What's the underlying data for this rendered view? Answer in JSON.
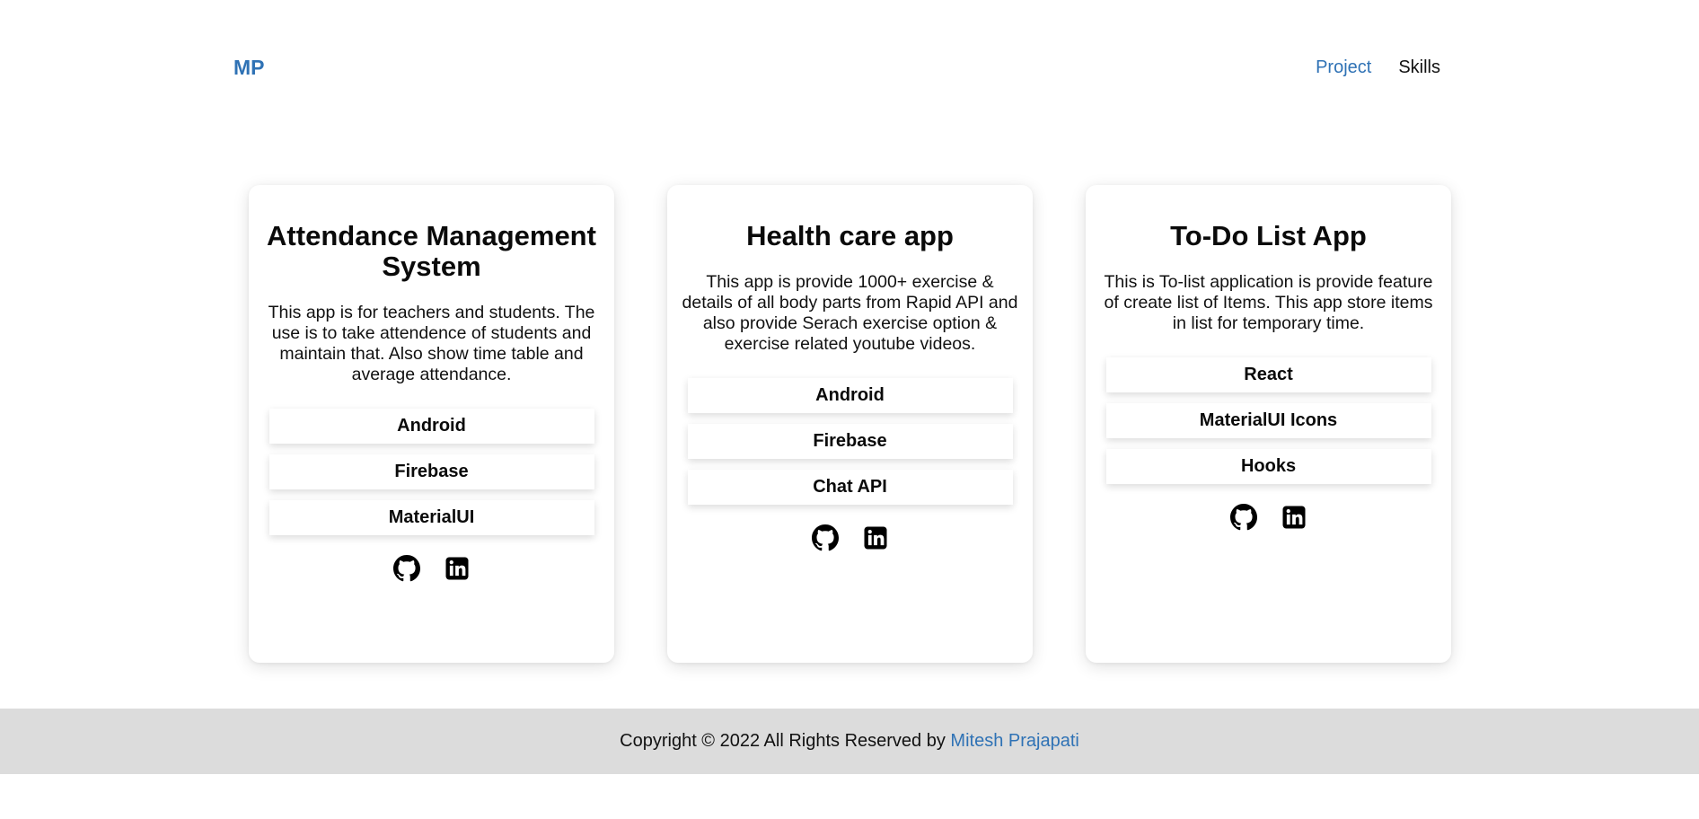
{
  "header": {
    "logo": "MP",
    "nav": [
      {
        "label": "Project",
        "active": true
      },
      {
        "label": "Skills",
        "active": false
      }
    ]
  },
  "projects": [
    {
      "title": "Attendance Management System",
      "description": "This app is for teachers and students. The use is to take attendence of students and maintain that. Also show time table and average attendance.",
      "tech": [
        "Android",
        "Firebase",
        "MaterialUI"
      ],
      "links": [
        "github-icon",
        "linkedin-icon"
      ]
    },
    {
      "title": "Health care app",
      "description": "This app is provide 1000+ exercise & details of all body parts from Rapid API and also provide Serach exercise option & exercise related youtube videos.",
      "tech": [
        "Android",
        "Firebase",
        "Chat API"
      ],
      "links": [
        "github-icon",
        "linkedin-icon"
      ]
    },
    {
      "title": "To-Do List App",
      "description": "This is To-list application is provide feature of create list of Items. This app store items in list for temporary time.",
      "tech": [
        "React",
        "MaterialUI Icons",
        "Hooks"
      ],
      "links": [
        "github-icon",
        "linkedin-icon"
      ]
    }
  ],
  "footer": {
    "text": "Copyright © 2022 All Rights Reserved by ",
    "author": "Mitesh Prajapati"
  },
  "colors": {
    "accent": "#2f72b5",
    "footer_bg": "#dcdcdc",
    "page_bg": "#ffffff"
  }
}
